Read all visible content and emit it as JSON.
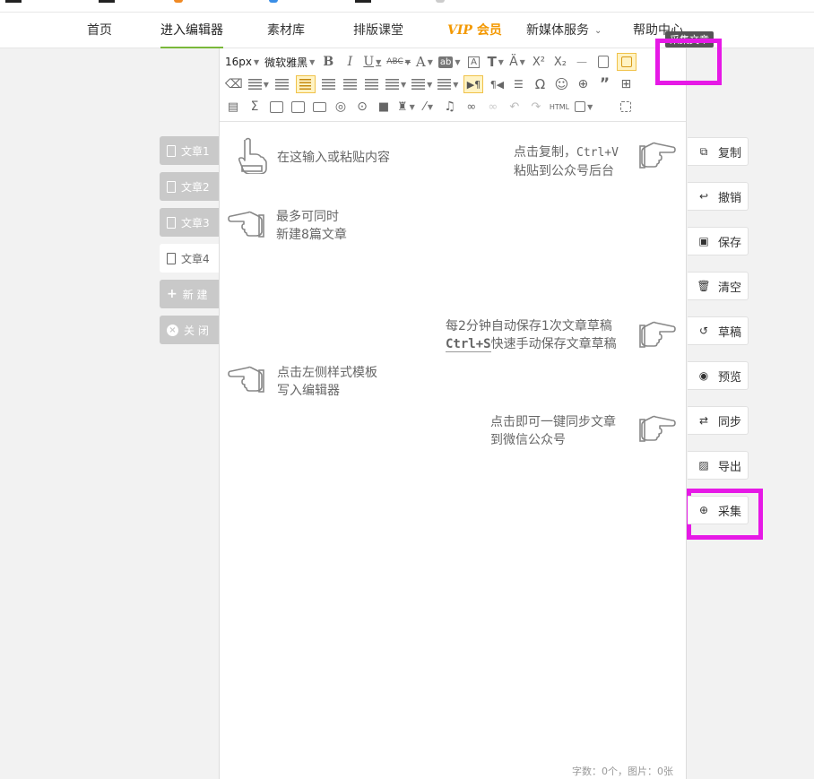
{
  "nav": {
    "home": "首页",
    "editor": "进入编辑器",
    "materials": "素材库",
    "layout_class": "排版课堂",
    "vip_prefix": "VIP",
    "vip_suffix": "会员",
    "media_service": "新媒体服务",
    "help_center": "帮助中心"
  },
  "toolbar": {
    "font_size": "16px",
    "font_family": "微软雅黑",
    "html_label": "HTML",
    "omega": "Ω"
  },
  "tooltip": "采集文章",
  "doc_tabs": [
    {
      "label": "文章1",
      "active": false
    },
    {
      "label": "文章2",
      "active": false
    },
    {
      "label": "文章3",
      "active": false
    },
    {
      "label": "文章4",
      "active": true
    },
    {
      "label": "新 建",
      "icon": "plus-icon"
    },
    {
      "label": "关 闭",
      "icon": "close-circle-icon"
    }
  ],
  "hints": {
    "input_line1": "在这输入或粘贴内容",
    "copy_line1_a": "点击复制，",
    "copy_line1_b": "Ctrl+V",
    "copy_line2": "粘贴到公众号后台",
    "max_line1": "最多可同时",
    "max_line2": "新建8篇文章",
    "save_line1": "每2分钟自动保存1次文章草稿",
    "save_line2_kbd": "Ctrl+S",
    "save_line2_rest": "快速手动保存文章草稿",
    "tpl_line1": "点击左侧样式模板",
    "tpl_line2": "写入编辑器",
    "sync_line1": "点击即可一键同步文章",
    "sync_line2": "到微信公众号"
  },
  "right_buttons": [
    {
      "label": "复制",
      "icon": "copy-icon"
    },
    {
      "label": "撤销",
      "icon": "undo-icon"
    },
    {
      "label": "保存",
      "icon": "save-icon"
    },
    {
      "label": "清空",
      "icon": "trash-icon"
    },
    {
      "label": "草稿",
      "icon": "history-icon"
    },
    {
      "label": "预览",
      "icon": "eye-icon"
    },
    {
      "label": "同步",
      "icon": "sync-icon"
    },
    {
      "label": "导出",
      "icon": "export-icon"
    },
    {
      "label": "采集",
      "icon": "zoom-in-icon"
    }
  ],
  "counter": "字数：0个，图片：0张",
  "colors": {
    "accent_green": "#7ab83a",
    "vip_orange": "#f39800",
    "highlight_magenta": "#e619e6",
    "tab_gray": "#c9c9c9"
  }
}
